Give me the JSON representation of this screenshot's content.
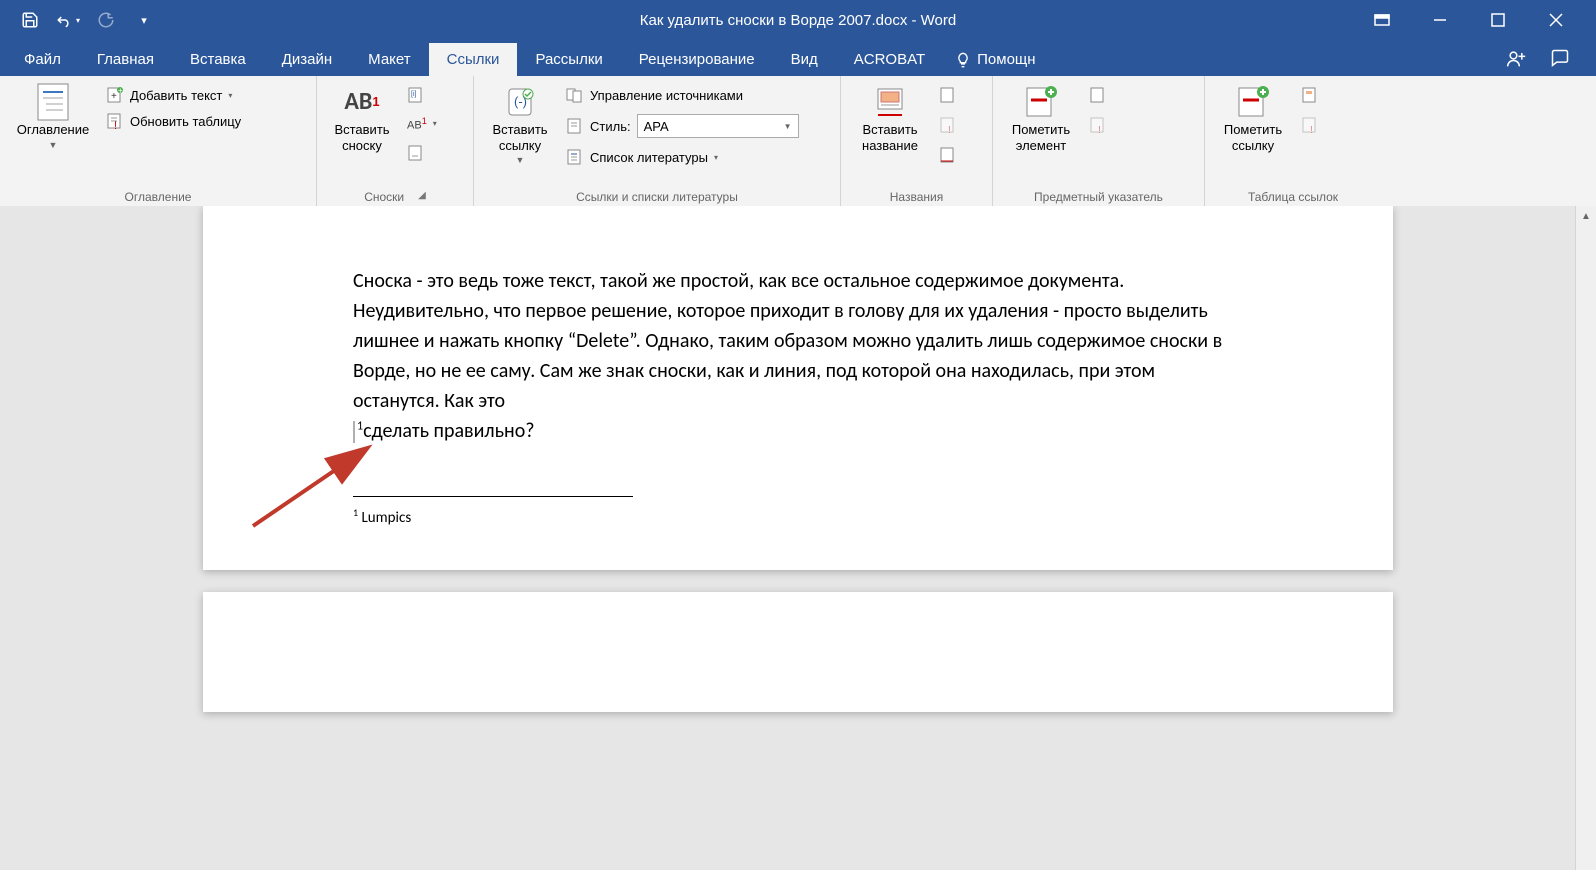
{
  "title": "Как удалить сноски в Ворде 2007.docx - Word",
  "tabs": {
    "file": "Файл",
    "home": "Главная",
    "insert": "Вставка",
    "design": "Дизайн",
    "layout": "Макет",
    "references": "Ссылки",
    "mailings": "Рассылки",
    "review": "Рецензирование",
    "view": "Вид",
    "acrobat": "ACROBAT",
    "tellme": "Помощн"
  },
  "ribbon": {
    "toc": {
      "btn": "Оглавление",
      "add_text": "Добавить текст",
      "update": "Обновить таблицу",
      "group": "Оглавление"
    },
    "footnotes": {
      "insert": "Вставить\nсноску",
      "letters": "AB",
      "group": "Сноски"
    },
    "citations": {
      "insert_link": "Вставить\nссылку",
      "manage": "Управление источниками",
      "style_label": "Стиль:",
      "style_value": "APA",
      "biblio": "Список литературы",
      "group": "Ссылки и списки литературы"
    },
    "captions": {
      "insert": "Вставить\nназвание",
      "group": "Названия"
    },
    "index": {
      "mark": "Пометить\nэлемент",
      "group": "Предметный указатель"
    },
    "toa": {
      "mark": "Пометить\nссылку",
      "group": "Таблица ссылок"
    }
  },
  "document": {
    "para": "Сноска - это ведь тоже текст, такой же простой, как все остальное содержимое документа. Неудивительно, что первое решение, которое приходит в голову для их удаления - просто выделить лишнее и нажать кнопку “",
    "delete_word": "Delete",
    "para2": "”. Однако, таким образом можно удалить лишь содержимое сноски в ",
    "word_word": "Ворде",
    "para3": ", но не ее саму. Сам же знак сноски, как и линия, под которой она находилась, при этом останутся. Как это ",
    "fn_mark": "1",
    "last_line": "сделать правильно?",
    "footnote_num": "1",
    "footnote_text": "Lumpics"
  }
}
